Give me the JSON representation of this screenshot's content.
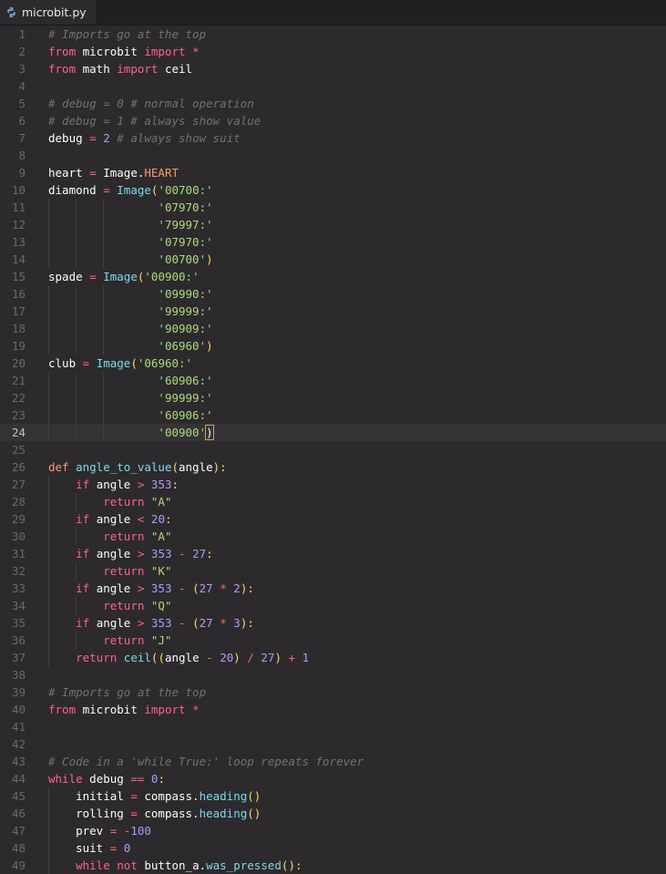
{
  "tab": {
    "filename": "microbit.py",
    "icon": "python-icon"
  },
  "current_line": 24,
  "lines": [
    "# Imports go at the top",
    "from microbit import *",
    "from math import ceil",
    "",
    "# debug = 0 # normal operation",
    "# debug = 1 # always show value",
    "debug = 2 # always show suit",
    "",
    "heart = Image.HEART",
    "diamond = Image('00700:'",
    "                '07970:'",
    "                '79997:'",
    "                '07970:'",
    "                '00700')",
    "spade = Image('00900:'",
    "                '09990:'",
    "                '99999:'",
    "                '90909:'",
    "                '06960')",
    "club = Image('06960:'",
    "                '60906:'",
    "                '99999:'",
    "                '60906:'",
    "                '00900')",
    "",
    "def angle_to_value(angle):",
    "    if angle > 353:",
    "        return \"A\"",
    "    if angle < 20:",
    "        return \"A\"",
    "    if angle > 353 - 27:",
    "        return \"K\"",
    "    if angle > 353 - (27 * 2):",
    "        return \"Q\"",
    "    if angle > 353 - (27 * 3):",
    "        return \"J\"",
    "    return ceil((angle - 20) / 27) + 1",
    "",
    "# Imports go at the top",
    "from microbit import *",
    "",
    "",
    "# Code in a 'while True:' loop repeats forever",
    "while debug == 0:",
    "    initial = compass.heading()",
    "    rolling = compass.heading()",
    "    prev = -100",
    "    suit = 0",
    "    while not button_a.was_pressed():"
  ]
}
